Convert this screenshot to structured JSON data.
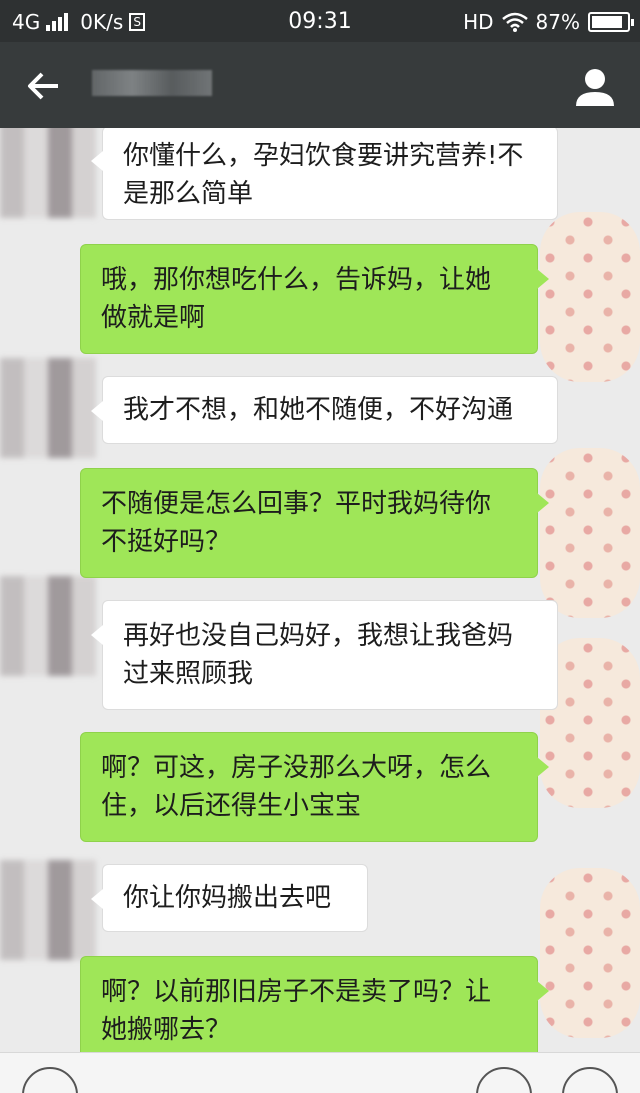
{
  "status": {
    "network": "4G",
    "speed": "0K/s",
    "sim_badge": "S",
    "time": "09:31",
    "hd": "HD",
    "battery": "87%",
    "battery_level": 0.87
  },
  "nav": {
    "back_icon": "arrow-left-icon",
    "profile_icon": "person-icon"
  },
  "messages": [
    {
      "side": "left",
      "text_lines": [
        "你懂什么，孕妇饮食要讲究营养!不",
        "是那么简单"
      ]
    },
    {
      "side": "right",
      "text_lines": [
        "哦，那你想吃什么，告诉妈，让她",
        "做就是啊"
      ]
    },
    {
      "side": "left",
      "text_lines": [
        "我才不想，和她不随便，不好沟通"
      ]
    },
    {
      "side": "right",
      "text_lines": [
        "不随便是怎么回事？平时我妈待你",
        "不挺好吗？"
      ]
    },
    {
      "side": "left",
      "text_lines": [
        "再好也没自己妈好，我想让我爸妈",
        "过来照顾我"
      ]
    },
    {
      "side": "right",
      "text_lines": [
        "啊？可这，房子没那么大呀，怎么",
        "住，以后还得生小宝宝"
      ]
    },
    {
      "side": "left",
      "text_lines": [
        "你让你妈搬出去吧"
      ]
    },
    {
      "side": "right",
      "text_lines": [
        "啊？以前那旧房子不是卖了吗？让",
        "她搬哪去？"
      ]
    }
  ]
}
